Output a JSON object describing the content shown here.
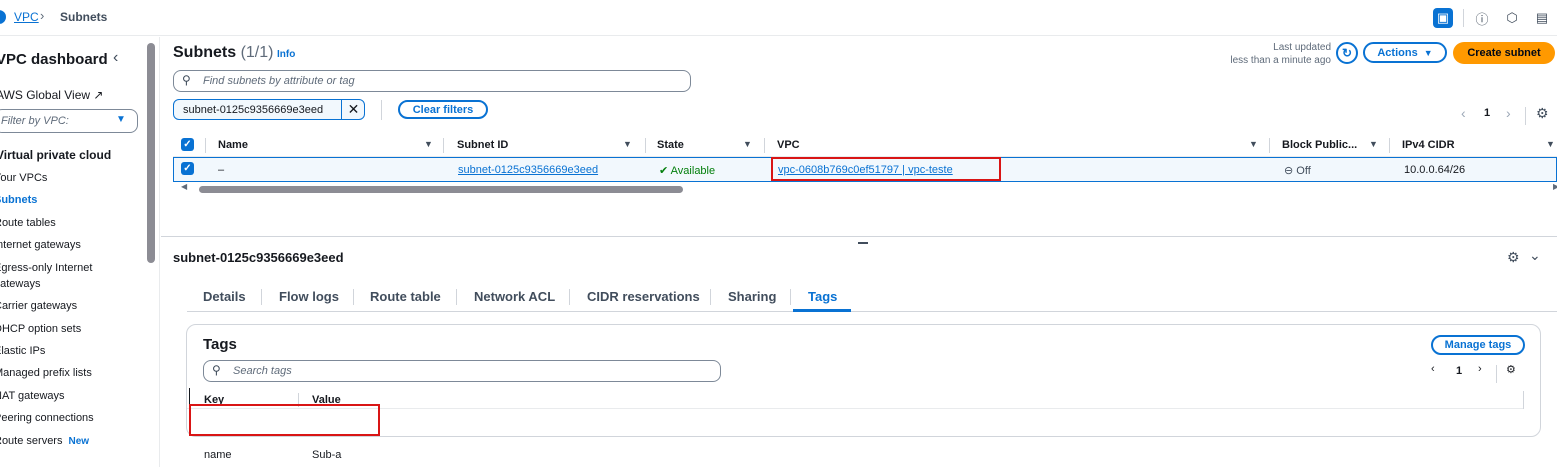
{
  "breadcrumb": {
    "root": "VPC",
    "current": "Subnets"
  },
  "sidebar": {
    "title": "VPC dashboard",
    "global_view": "AWS Global View",
    "filter_placeholder": "Filter by VPC:",
    "section": "Virtual private cloud",
    "items": [
      {
        "label": "Your VPCs"
      },
      {
        "label": "Subnets",
        "active": true
      },
      {
        "label": "Route tables"
      },
      {
        "label": "Internet gateways"
      },
      {
        "label": "Egress-only Internet gateways"
      },
      {
        "label": "Carrier gateways"
      },
      {
        "label": "DHCP option sets"
      },
      {
        "label": "Elastic IPs"
      },
      {
        "label": "Managed prefix lists"
      },
      {
        "label": "NAT gateways"
      },
      {
        "label": "Peering connections"
      },
      {
        "label": "Route servers",
        "badge": "New"
      }
    ]
  },
  "header": {
    "title": "Subnets",
    "count": "(1/1)",
    "info": "Info",
    "last_updated_label": "Last updated",
    "last_updated_value": "less than a minute ago",
    "actions_label": "Actions",
    "create_label": "Create subnet"
  },
  "search": {
    "placeholder": "Find subnets by attribute or tag"
  },
  "filter_token": "subnet-0125c9356669e3eed",
  "clear_filters": "Clear filters",
  "pager": {
    "page": "1"
  },
  "table": {
    "columns": [
      "Name",
      "Subnet ID",
      "State",
      "VPC",
      "Block Public...",
      "IPv4 CIDR"
    ],
    "rows": [
      {
        "name": "–",
        "subnet_id": "subnet-0125c9356669e3eed",
        "state": "Available",
        "vpc": "vpc-0608b769c0ef51797 | vpc-teste",
        "block_public": "Off",
        "ipv4_cidr": "10.0.0.64/26"
      }
    ]
  },
  "details": {
    "title": "subnet-0125c9356669e3eed",
    "tabs": [
      "Details",
      "Flow logs",
      "Route table",
      "Network ACL",
      "CIDR reservations",
      "Sharing",
      "Tags"
    ],
    "active_tab": "Tags",
    "tags_card": {
      "title": "Tags",
      "manage_label": "Manage tags",
      "search_placeholder": "Search tags",
      "page": "1",
      "columns": [
        "Key",
        "Value"
      ],
      "rows": [
        {
          "key": "name",
          "value": "Sub-a"
        }
      ]
    }
  },
  "colors": {
    "accent": "#0972d3",
    "primary_button": "#ff9900",
    "success": "#037f0c",
    "highlight": "#d91515"
  }
}
